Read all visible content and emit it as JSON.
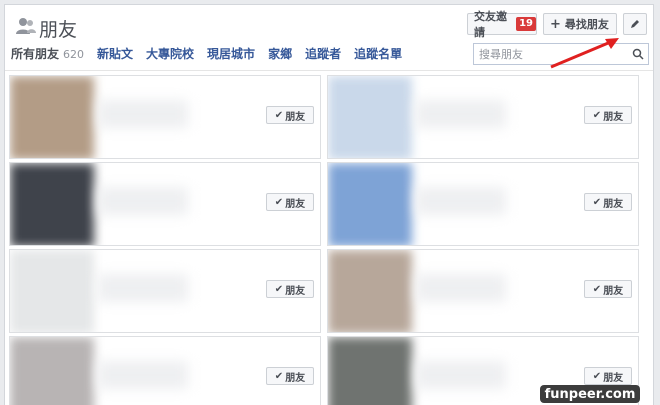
{
  "header": {
    "title": "朋友",
    "requests_label": "交友邀請",
    "requests_count": "19",
    "find_label": "尋找朋友"
  },
  "tabs": [
    {
      "label": "所有朋友",
      "count": "620"
    },
    {
      "label": "新貼文"
    },
    {
      "label": "大專院校"
    },
    {
      "label": "現居城市"
    },
    {
      "label": "家鄉"
    },
    {
      "label": "追蹤者"
    },
    {
      "label": "追蹤名單"
    }
  ],
  "search": {
    "placeholder": "搜尋朋友"
  },
  "friend_button_label": "朋友",
  "cards": [
    {
      "photo_color": "#b39c86"
    },
    {
      "photo_color": "#c9d8ea"
    },
    {
      "photo_color": "#3f434b"
    },
    {
      "photo_color": "#7ea3d6"
    },
    {
      "photo_color": "#e5e7e8"
    },
    {
      "photo_color": "#b7a79a"
    },
    {
      "photo_color": "#b8b4b4"
    },
    {
      "photo_color": "#6f7370"
    }
  ],
  "watermark": "funpeer.com",
  "colors": {
    "link": "#365899",
    "badge": "#d93a3a",
    "arrow": "#e02020"
  }
}
